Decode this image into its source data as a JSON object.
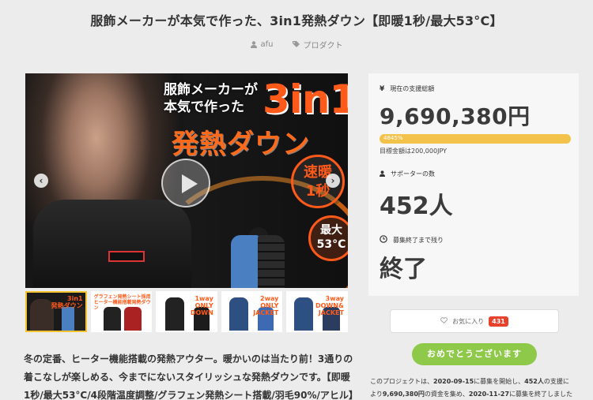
{
  "title": "服飾メーカーが本気で作った、3in1発熱ダウン【即暖1秒/最大53°C】",
  "meta": {
    "author": "afu",
    "category": "プロダクト"
  },
  "hero": {
    "headline_line1": "服飾メーカーが",
    "headline_line2": "本気で作った",
    "big": "3in1",
    "sub": "発熱ダウン",
    "badge1_line1": "速暖",
    "badge1_line2": "1秒",
    "badge2_line1": "最大",
    "badge2_line2": "53°C",
    "arrow_left": "‹",
    "arrow_right": "›"
  },
  "thumbnails": [
    {
      "label": "3in1\n発熱ダウン",
      "top": ""
    },
    {
      "label": "",
      "top": "グラフェン発熱シート採用 ヒーター機能搭載発熱ダウン"
    },
    {
      "label": "1way\nONLY\nDOWN",
      "top": ""
    },
    {
      "label": "2way\nONLY\nJACKET",
      "top": ""
    },
    {
      "label": "3way\nDOWN&\nJACKET",
      "top": ""
    }
  ],
  "description": "冬の定番、ヒーター機能搭載の発熱アウター。暖かいのは当たり前！3通りの着こなしが楽しめる、今までにないスタイリッシュな発熱ダウンです。【即暖1秒/最大53°C/4段階温度調整/グラフェン発熱シート搭載/羽毛90%/アヒル】",
  "stats": {
    "funding_label": "現在の支援総額",
    "funding_value": "9,690,380円",
    "progress_text": "4845%",
    "goal_text": "目標金額は200,000JPY",
    "supporters_label": "サポーターの数",
    "supporters_value": "452人",
    "remaining_label": "募集終了まで残り",
    "remaining_value": "終了"
  },
  "favorite": {
    "label": "お気に入り",
    "count": "431"
  },
  "done_button": "おめでとうございます",
  "summary": {
    "p1": "このプロジェクトは、",
    "start": "2020-09-15",
    "p2": "に募集を開始し、",
    "people": "452人",
    "p3": "の支援に",
    "p4": "より",
    "amount": "9,690,380円",
    "p5": "の資金を集め、",
    "end": "2020-11-27",
    "p6": "に募集を終了しました"
  },
  "colors": {
    "accent_orange": "#ff5a1a",
    "progress": "#f2c24a",
    "success": "#8fc94a",
    "favorite_badge": "#e8422d"
  }
}
